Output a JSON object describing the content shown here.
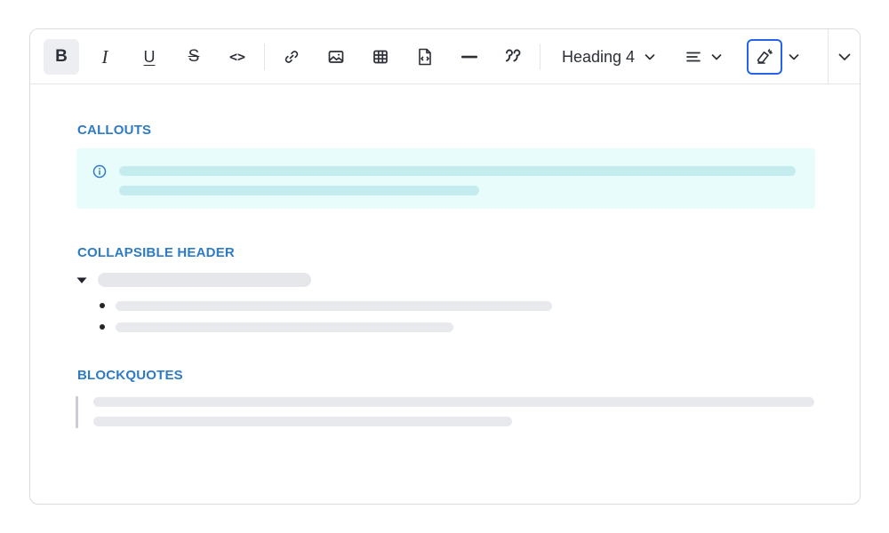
{
  "toolbar": {
    "buttons": [
      {
        "id": "bold",
        "label": "B",
        "icon": "bold-icon",
        "state": "active"
      },
      {
        "id": "italic",
        "label": "I",
        "icon": "italic-icon"
      },
      {
        "id": "underline",
        "label": "U",
        "icon": "underline-icon"
      },
      {
        "id": "strikethrough",
        "label": "S",
        "icon": "strikethrough-icon"
      },
      {
        "id": "code",
        "label": "<>",
        "icon": "code-icon"
      },
      {
        "id": "link",
        "icon": "link-icon"
      },
      {
        "id": "image",
        "icon": "image-icon"
      },
      {
        "id": "table",
        "icon": "table-icon"
      },
      {
        "id": "embed",
        "icon": "embed-file-icon"
      },
      {
        "id": "horizontal-rule",
        "icon": "horizontal-rule-icon"
      },
      {
        "id": "blockquote",
        "icon": "quote-icon"
      },
      {
        "id": "clear-format",
        "icon": "eraser-icon",
        "state": "selected"
      }
    ],
    "heading_select": {
      "value": "Heading 4"
    },
    "align_select": {
      "icon": "align-left-icon"
    },
    "more_icon": "chevron-down-icon"
  },
  "sections": {
    "callouts": {
      "title": "CALLOUTS",
      "icon": "info-icon"
    },
    "collapsible": {
      "title": "COLLAPSIBLE HEADER",
      "icon": "caret-down-icon"
    },
    "blockquotes": {
      "title": "BLOCKQUOTES"
    }
  },
  "colors": {
    "accent": "#2e7bc4",
    "selected_border": "#2563eb",
    "callout_bg": "#e8fcfc",
    "callout_bar": "#c4ecee",
    "placeholder_bar": "#e8e9ed"
  }
}
